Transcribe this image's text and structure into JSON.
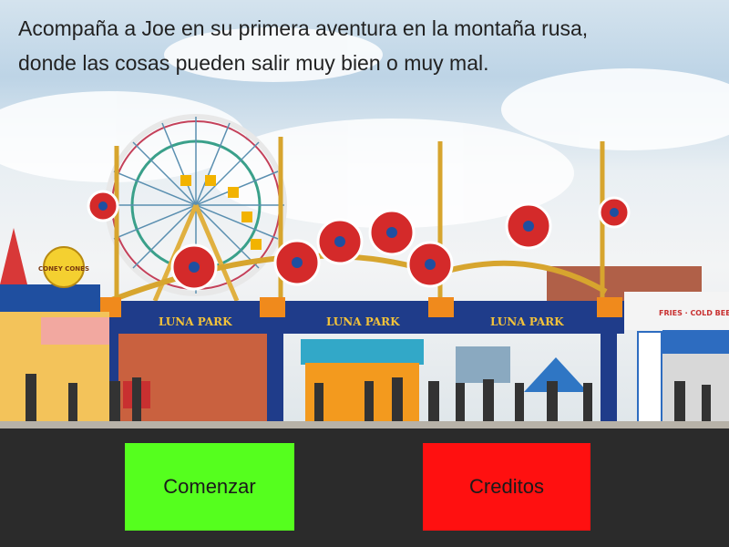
{
  "intro": {
    "line1": "Acompaña a Joe en su primera aventura en la montaña rusa,",
    "line2": "donde las cosas pueden salir muy bien o muy mal."
  },
  "scene": {
    "sign_text": "LUNA PARK",
    "stand_sign": "CONEY CONES",
    "shop_sign": "FRIES · COLD BEER ·"
  },
  "buttons": {
    "start": {
      "label": "Comenzar",
      "color": "#55ff1e"
    },
    "credits": {
      "label": "Creditos",
      "color": "#ff1010"
    }
  }
}
